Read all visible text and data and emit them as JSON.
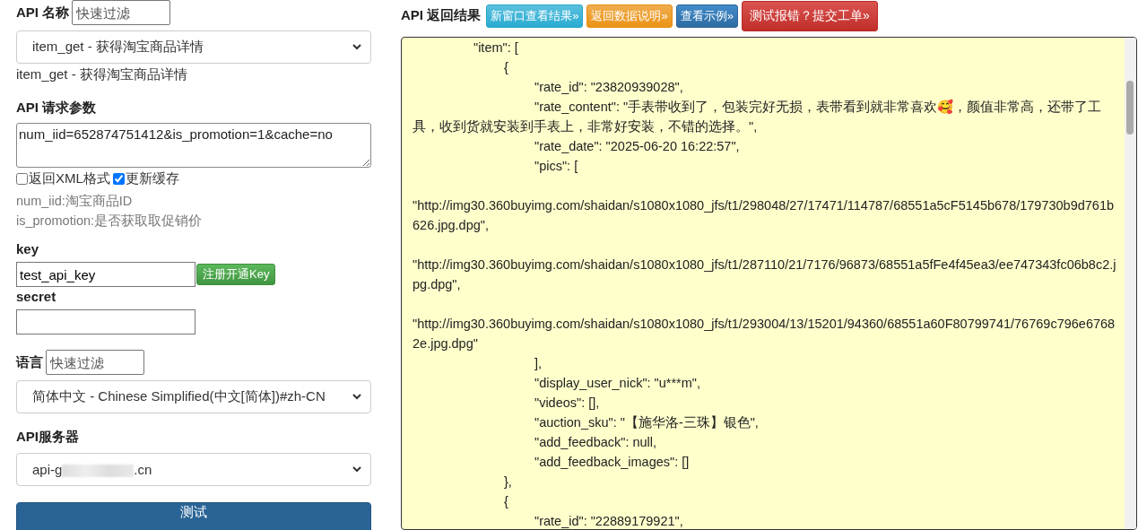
{
  "api_name": {
    "label": "API 名称",
    "filter_placeholder": "快速过滤",
    "selected": "item_get - 获得淘宝商品详情",
    "description": "item_get - 获得淘宝商品详情"
  },
  "params": {
    "label": "API 请求参数",
    "value": "num_iid=652874751412&is_promotion=1&cache=no",
    "options": [
      {
        "label": "返回XML格式",
        "checked": false
      },
      {
        "label": "更新缓存",
        "checked": true
      }
    ],
    "help": [
      "num_iid:淘宝商品ID",
      "is_promotion:是否获取取促销价"
    ]
  },
  "key": {
    "label": "key",
    "value": "test_api_key",
    "register_button": "注册开通Key"
  },
  "secret": {
    "label": "secret"
  },
  "language": {
    "label": "语言",
    "filter_placeholder": "快速过滤",
    "selected": "简体中文 - Chinese Simplified(中文[简体])#zh-CN"
  },
  "server": {
    "label": "API服务器",
    "value_start": "api-g",
    "value_end": ".cn"
  },
  "test_button": "测试",
  "result": {
    "label": "API 返回结果",
    "buttons": [
      {
        "label": "新窗口查看结果»",
        "kind": "info"
      },
      {
        "label": "返回数据说明»",
        "kind": "warning"
      },
      {
        "label": "查看示例»",
        "kind": "primary"
      },
      {
        "label": "测试报错？提交工单»",
        "kind": "danger"
      }
    ],
    "text": "\t\t\"item\": [\n\t\t\t{\n\t\t\t\t\"rate_id\": \"23820939028\",\n\t\t\t\t\"rate_content\": \"手表带收到了，包装完好无损，表带看到就非常喜欢🥰，颜值非常高，还带了工具，收到货就安装到手表上，非常好安装，不错的选择。\",\n\t\t\t\t\"rate_date\": \"2025-06-20 16:22:57\",\n\t\t\t\t\"pics\": [\n\n\"http://img30.360buyimg.com/shaidan/s1080x1080_jfs/t1/298048/27/17471/114787/68551a5cF5145b678/179730b9d761b626.jpg.dpg\",\n\n\"http://img30.360buyimg.com/shaidan/s1080x1080_jfs/t1/287110/21/7176/96873/68551a5fFe4f45ea3/ee747343fc06b8c2.jpg.dpg\",\n\n\"http://img30.360buyimg.com/shaidan/s1080x1080_jfs/t1/293004/13/15201/94360/68551a60F80799741/76769c796e67682e.jpg.dpg\"\n\t\t\t\t],\n\t\t\t\t\"display_user_nick\": \"u***m\",\n\t\t\t\t\"videos\": [],\n\t\t\t\t\"auction_sku\": \"【施华洛-三珠】银色\",\n\t\t\t\t\"add_feedback\": null,\n\t\t\t\t\"add_feedback_images\": []\n\t\t\t},\n\t\t\t{\n\t\t\t\t\"rate_id\": \"22889179921\","
  }
}
